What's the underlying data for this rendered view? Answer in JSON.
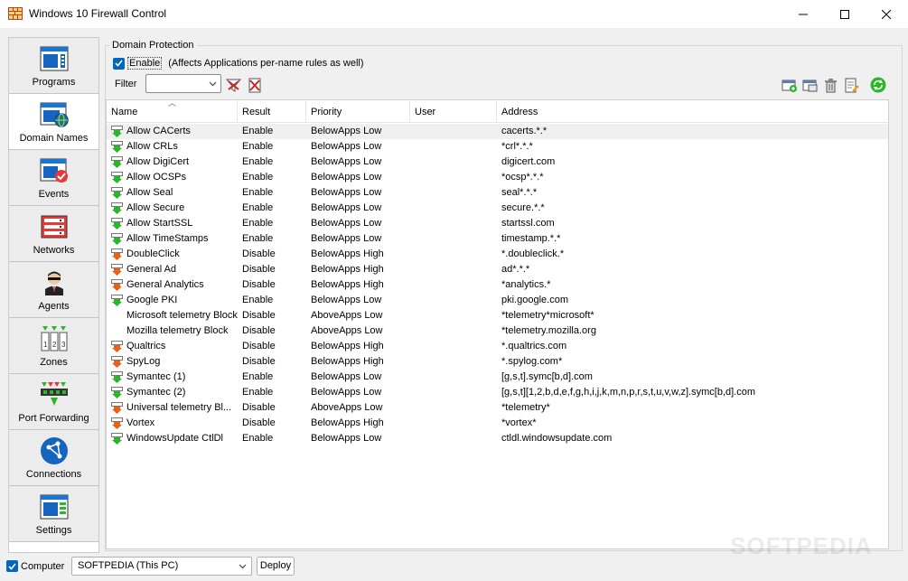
{
  "window": {
    "title": "Windows 10 Firewall Control"
  },
  "sidebar": {
    "items": [
      {
        "label": "Programs",
        "icon": "programs-icon"
      },
      {
        "label": "Domain Names",
        "icon": "domain-names-icon",
        "active": true
      },
      {
        "label": "Events",
        "icon": "events-icon"
      },
      {
        "label": "Networks",
        "icon": "networks-icon"
      },
      {
        "label": "Agents",
        "icon": "agents-icon"
      },
      {
        "label": "Zones",
        "icon": "zones-icon"
      },
      {
        "label": "Port Forwarding",
        "icon": "port-forwarding-icon"
      },
      {
        "label": "Connections",
        "icon": "connections-icon"
      },
      {
        "label": "Settings",
        "icon": "settings-icon"
      }
    ]
  },
  "domain": {
    "group_title": "Domain Protection",
    "enable_label": "Enable",
    "enable_checked": true,
    "enable_hint": "(Affects Applications per-name rules as well)",
    "filter_label": "Filter",
    "filter_value": ""
  },
  "table": {
    "columns": [
      "Name",
      "Result",
      "Priority",
      "User",
      "Address"
    ],
    "rows": [
      {
        "name": "Allow CACerts",
        "result": "Enable",
        "priority": "BelowApps Low",
        "user": "",
        "address": "cacerts.*.*",
        "icon": "allow"
      },
      {
        "name": "Allow CRLs",
        "result": "Enable",
        "priority": "BelowApps Low",
        "user": "",
        "address": "*crl*.*.*",
        "icon": "allow"
      },
      {
        "name": "Allow DigiCert",
        "result": "Enable",
        "priority": "BelowApps Low",
        "user": "",
        "address": "digicert.com",
        "icon": "allow"
      },
      {
        "name": "Allow OCSPs",
        "result": "Enable",
        "priority": "BelowApps Low",
        "user": "",
        "address": "*ocsp*.*.*",
        "icon": "allow"
      },
      {
        "name": "Allow Seal",
        "result": "Enable",
        "priority": "BelowApps Low",
        "user": "",
        "address": "seal*.*.*",
        "icon": "allow"
      },
      {
        "name": "Allow Secure",
        "result": "Enable",
        "priority": "BelowApps Low",
        "user": "",
        "address": "secure.*.*",
        "icon": "allow"
      },
      {
        "name": "Allow StartSSL",
        "result": "Enable",
        "priority": "BelowApps Low",
        "user": "",
        "address": "startssl.com",
        "icon": "allow"
      },
      {
        "name": "Allow TimeStamps",
        "result": "Enable",
        "priority": "BelowApps Low",
        "user": "",
        "address": "timestamp.*.*",
        "icon": "allow"
      },
      {
        "name": "DoubleClick",
        "result": "Disable",
        "priority": "BelowApps High",
        "user": "",
        "address": "*.doubleclick.*",
        "icon": "block"
      },
      {
        "name": "General Ad",
        "result": "Disable",
        "priority": "BelowApps High",
        "user": "",
        "address": "ad*.*.*",
        "icon": "block"
      },
      {
        "name": "General Analytics",
        "result": "Disable",
        "priority": "BelowApps High",
        "user": "",
        "address": "*analytics.*",
        "icon": "block"
      },
      {
        "name": "Google PKI",
        "result": "Enable",
        "priority": "BelowApps Low",
        "user": "",
        "address": "pki.google.com",
        "icon": "allow"
      },
      {
        "name": "Microsoft telemetry Block",
        "result": "Disable",
        "priority": "AboveApps Low",
        "user": "",
        "address": "*telemetry*microsoft*",
        "icon": "none"
      },
      {
        "name": "Mozilla telemetry Block",
        "result": "Disable",
        "priority": "AboveApps Low",
        "user": "",
        "address": "*telemetry.mozilla.org",
        "icon": "none"
      },
      {
        "name": "Qualtrics",
        "result": "Disable",
        "priority": "BelowApps High",
        "user": "",
        "address": "*.qualtrics.com",
        "icon": "block"
      },
      {
        "name": "SpyLog",
        "result": "Disable",
        "priority": "BelowApps High",
        "user": "",
        "address": "*.spylog.com*",
        "icon": "block"
      },
      {
        "name": "Symantec (1)",
        "result": "Enable",
        "priority": "BelowApps Low",
        "user": "",
        "address": "[g,s,t].symc[b,d].com",
        "icon": "allow"
      },
      {
        "name": "Symantec (2)",
        "result": "Enable",
        "priority": "BelowApps Low",
        "user": "",
        "address": "[g,s,t][1,2,b,d,e,f,g,h,i,j,k,m,n,p,r,s,t,u,v,w,z].symc[b,d].com",
        "icon": "allow"
      },
      {
        "name": "Universal telemetry Bl...",
        "result": "Disable",
        "priority": "AboveApps Low",
        "user": "",
        "address": "*telemetry*",
        "icon": "block"
      },
      {
        "name": "Vortex",
        "result": "Disable",
        "priority": "BelowApps High",
        "user": "",
        "address": "*vortex*",
        "icon": "block"
      },
      {
        "name": "WindowsUpdate CtlDl",
        "result": "Enable",
        "priority": "BelowApps Low",
        "user": "",
        "address": "ctldl.windowsupdate.com",
        "icon": "allow"
      }
    ]
  },
  "footer": {
    "computer_label": "Computer",
    "computer_checked": true,
    "computer_value": "SOFTPEDIA (This PC)",
    "deploy_label": "Deploy"
  },
  "watermark": "SOFTPEDIA",
  "colors": {
    "accent": "#0067c0",
    "allow": "#2db52d",
    "block": "#e8621a"
  }
}
